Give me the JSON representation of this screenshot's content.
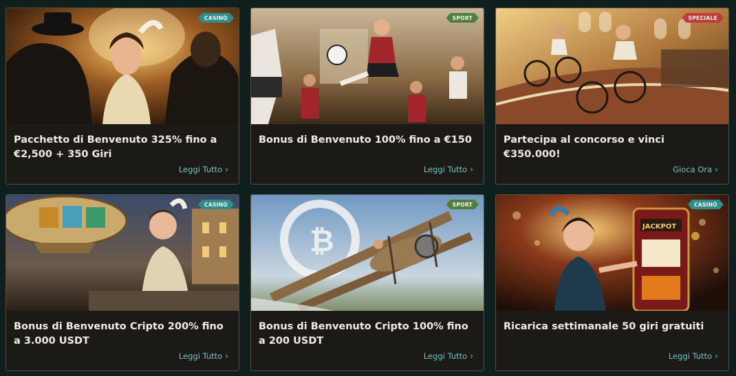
{
  "colors": {
    "background": "#0f1f1e",
    "card": "#1b1a17",
    "border": "#5a4f3c",
    "link": "#6fc6c6",
    "badge_casino": "#2f8e8a",
    "badge_sport": "#4f7f3a",
    "badge_speciale": "#c23b3b"
  },
  "cards": [
    {
      "badge": "CASINÒ",
      "title": "Pacchetto di Benvenuto 325% fino a €2,500 + 350 Giri",
      "link": "Leggi Tutto",
      "image": "flapper-dancer-art-deco-image"
    },
    {
      "badge": "SPORT",
      "title": "Bonus di Benvenuto 100% fino a €150",
      "link": "Leggi Tutto",
      "image": "vintage-football-player-image"
    },
    {
      "badge": "SPECIALE",
      "title": "Partecipa al concorso e vinci €350.000!",
      "link": "Gioca Ora",
      "image": "vintage-cycling-race-image"
    },
    {
      "badge": "CASINÒ",
      "title": "Bonus di Benvenuto Cripto 200% fino a 3.000 USDT",
      "link": "Leggi Tutto",
      "image": "crypto-airship-flapper-image"
    },
    {
      "badge": "SPORT",
      "title": "Bonus di Benvenuto Cripto 100% fino a 200 USDT",
      "link": "Leggi Tutto",
      "image": "biplane-bitcoin-skywriting-image"
    },
    {
      "badge": "CASINÒ",
      "title": "Ricarica settimanale 50 giri gratuiti",
      "link": "Leggi Tutto",
      "image": "jackpot-slot-machine-image"
    }
  ]
}
